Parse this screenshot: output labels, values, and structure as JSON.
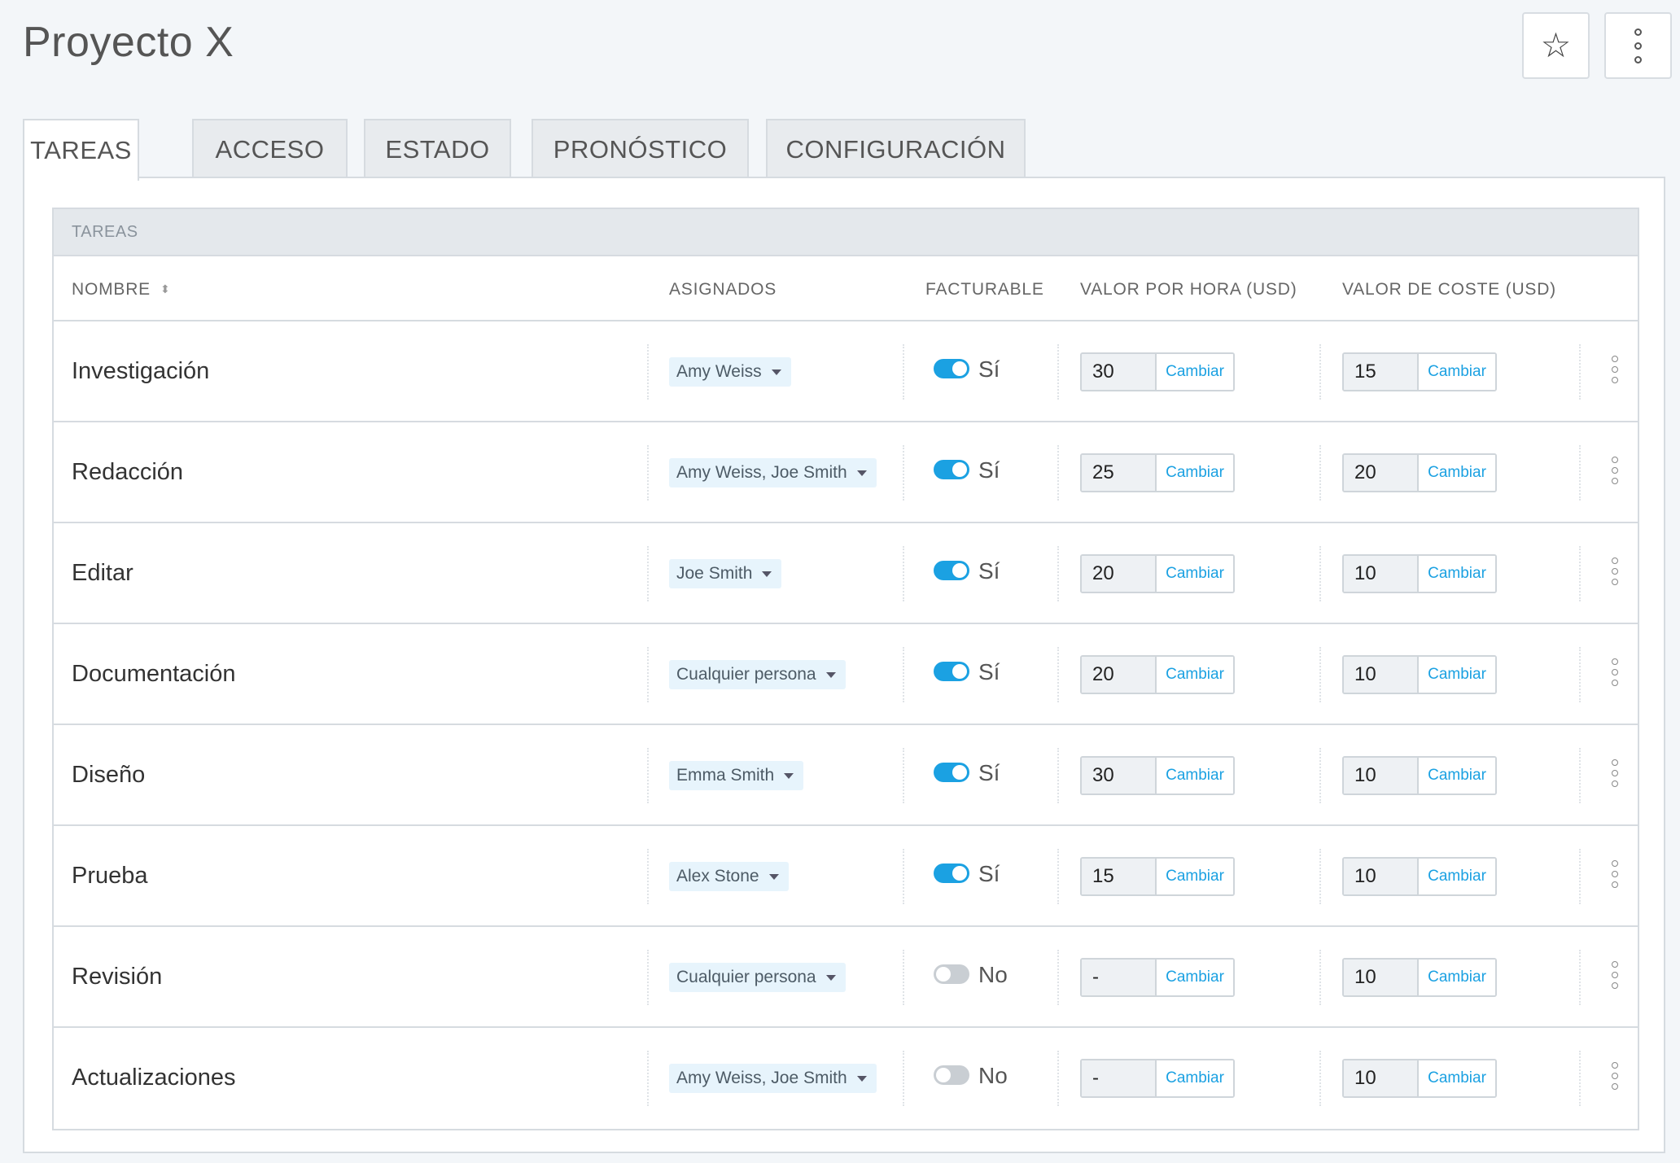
{
  "header": {
    "title": "Proyecto X",
    "star_icon": "star-outline-icon",
    "more_icon": "vertical-dots-icon"
  },
  "tabs": [
    {
      "label": "TAREAS",
      "active": true
    },
    {
      "label": "ACCESO",
      "active": false
    },
    {
      "label": "ESTADO",
      "active": false
    },
    {
      "label": "PRONÓSTICO",
      "active": false
    },
    {
      "label": "CONFIGURACIÓN",
      "active": false
    }
  ],
  "table": {
    "section_title": "TAREAS",
    "columns": {
      "name": "NOMBRE",
      "assignees": "ASIGNADOS",
      "billable": "FACTURABLE",
      "hourly_rate": "VALOR POR HORA (USD)",
      "cost_rate": "VALOR DE COSTE (USD)"
    },
    "change_label": "Cambiar",
    "rows": [
      {
        "name": "Investigación",
        "assignees": "Amy Weiss",
        "billable": true,
        "billable_label": "Sí",
        "hourly": "30",
        "cost": "15"
      },
      {
        "name": "Redacción",
        "assignees": "Amy Weiss, Joe Smith",
        "billable": true,
        "billable_label": "Sí",
        "hourly": "25",
        "cost": "20"
      },
      {
        "name": "Editar",
        "assignees": "Joe Smith",
        "billable": true,
        "billable_label": "Sí",
        "hourly": "20",
        "cost": "10"
      },
      {
        "name": "Documentación",
        "assignees": "Cualquier persona",
        "billable": true,
        "billable_label": "Sí",
        "hourly": "20",
        "cost": "10"
      },
      {
        "name": "Diseño",
        "assignees": "Emma Smith",
        "billable": true,
        "billable_label": "Sí",
        "hourly": "30",
        "cost": "10"
      },
      {
        "name": "Prueba",
        "assignees": "Alex Stone",
        "billable": true,
        "billable_label": "Sí",
        "hourly": "15",
        "cost": "10"
      },
      {
        "name": "Revisión",
        "assignees": "Cualquier persona",
        "billable": false,
        "billable_label": "No",
        "hourly": "-",
        "cost": "10"
      },
      {
        "name": "Actualizaciones",
        "assignees": "Amy Weiss, Joe Smith",
        "billable": false,
        "billable_label": "No",
        "hourly": "-",
        "cost": "10"
      }
    ]
  },
  "colors": {
    "accent": "#1ba1e2",
    "toggle_off": "#c9ced3",
    "assignee_bg": "#e7f4fc"
  }
}
